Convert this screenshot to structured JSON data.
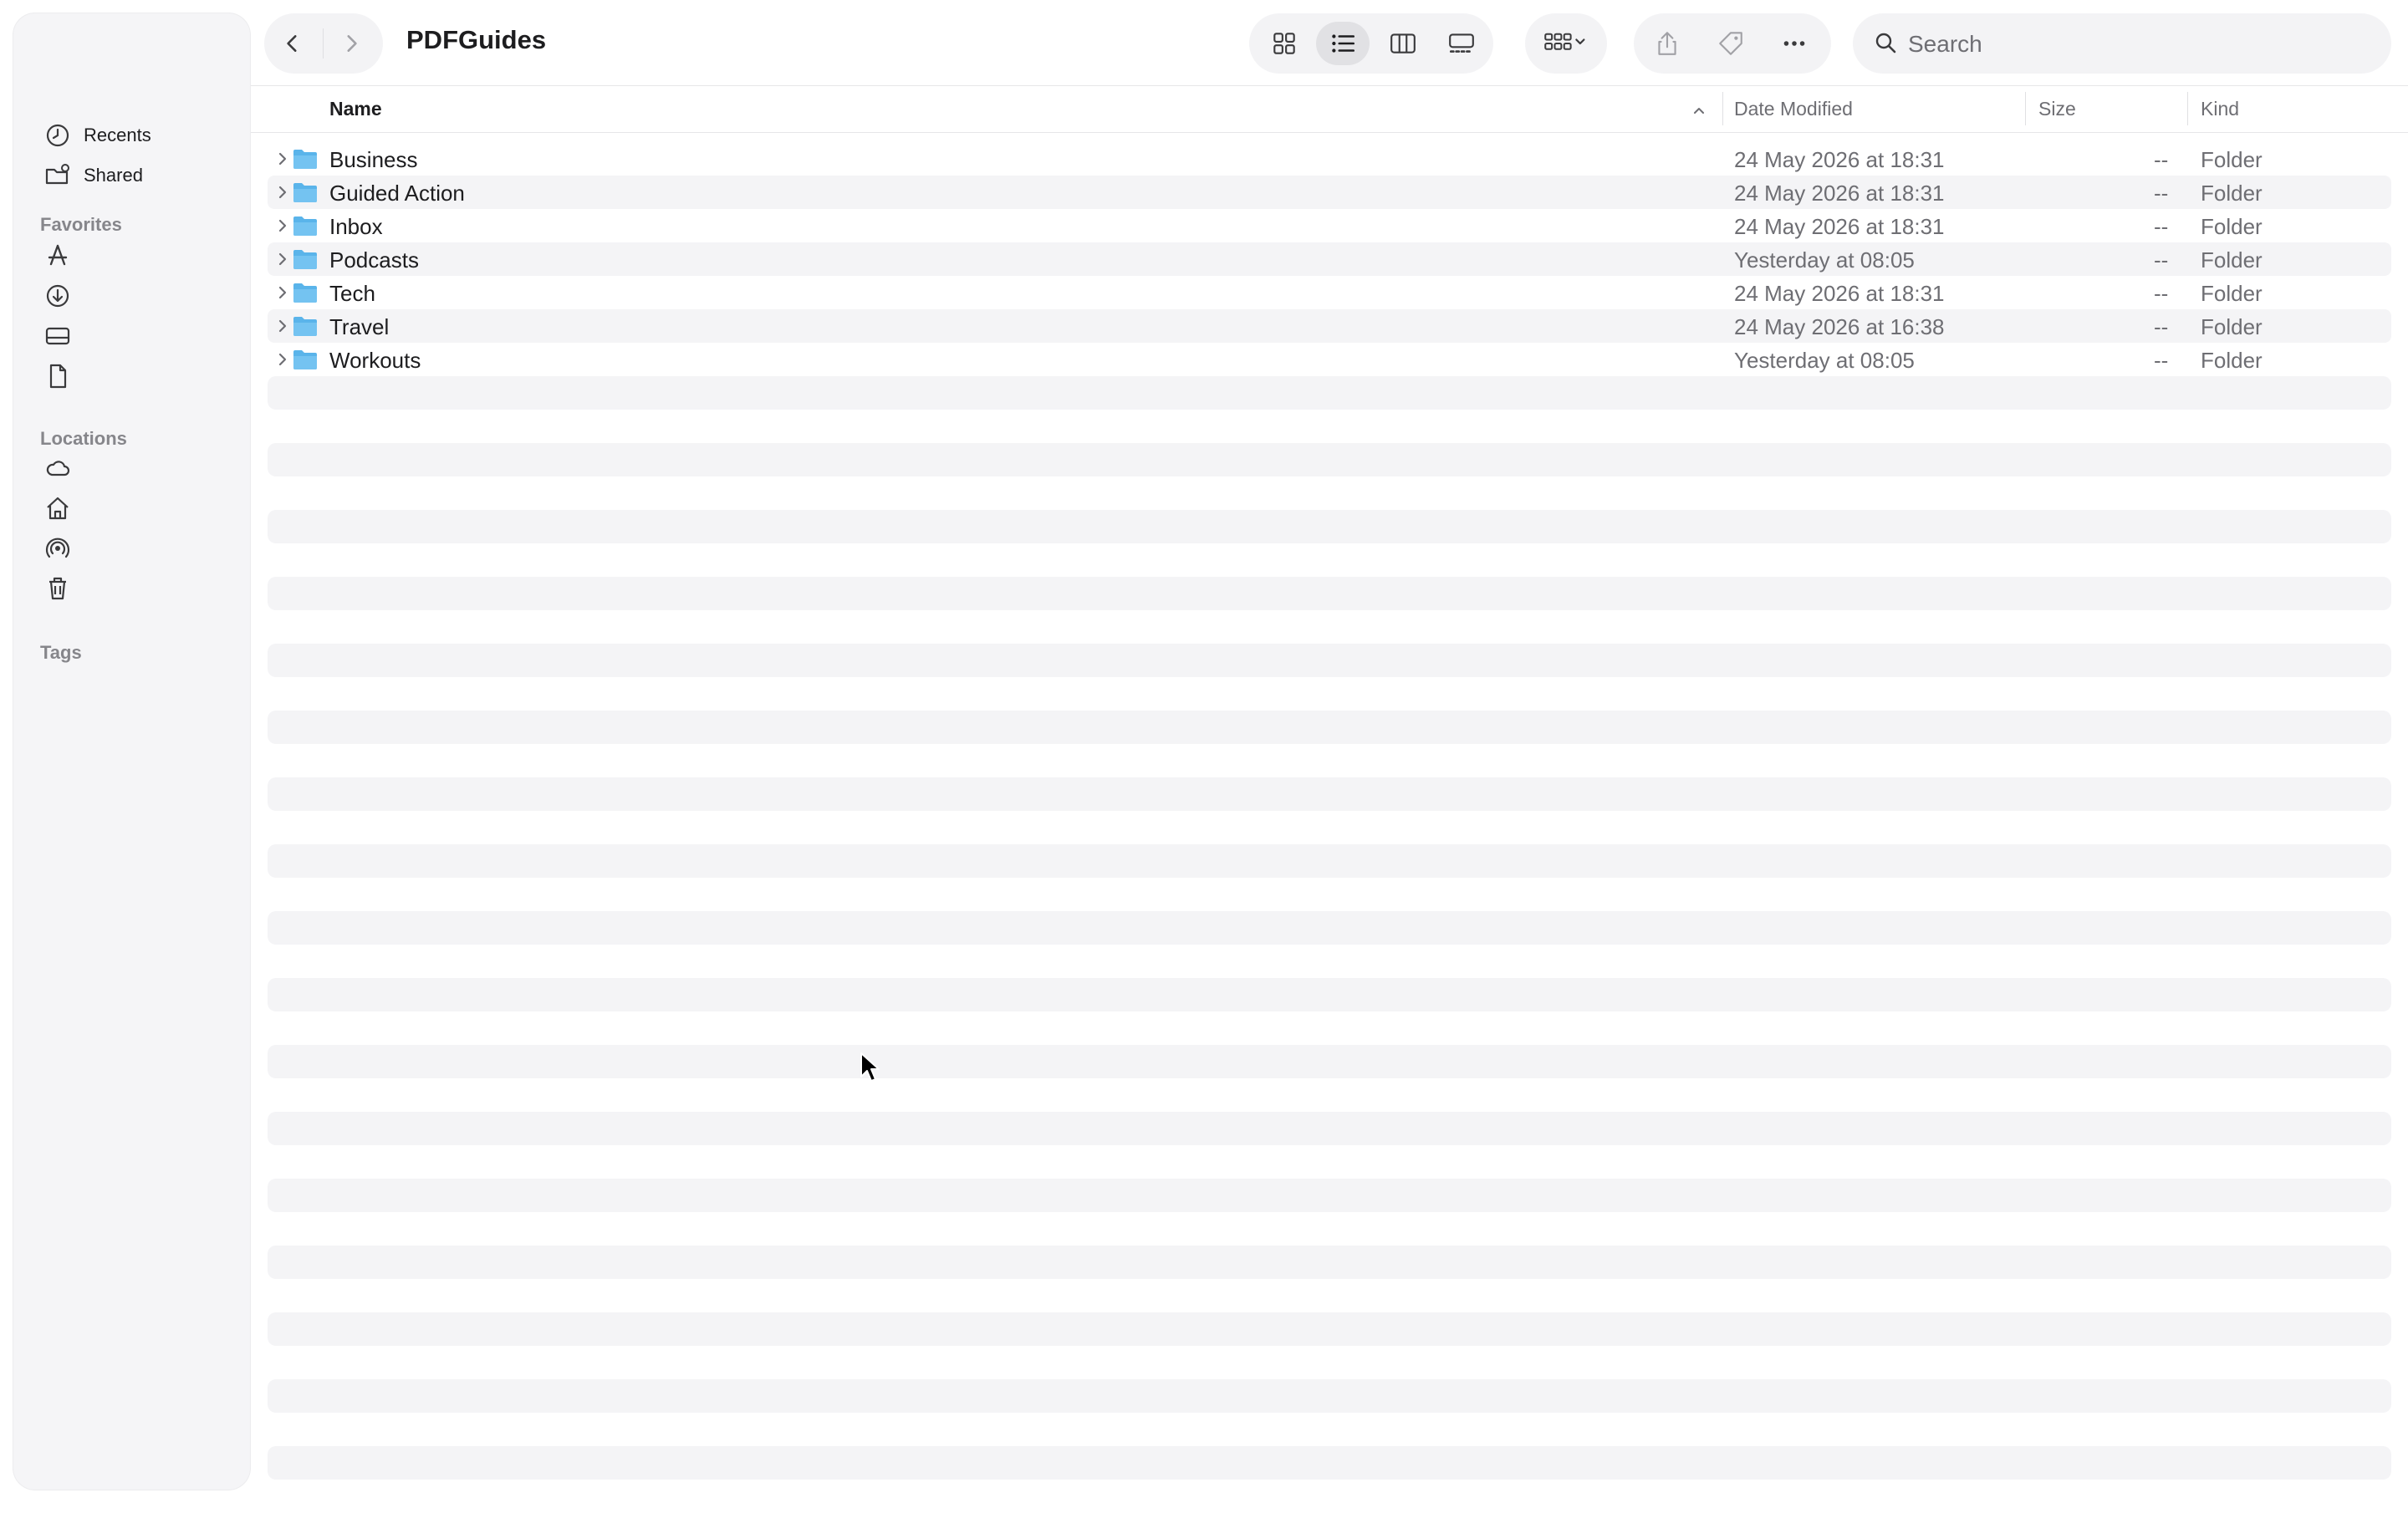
{
  "window": {
    "title": "PDFGuides"
  },
  "sidebar": {
    "top_items": [
      {
        "label": "Recents",
        "icon": "clock-icon"
      },
      {
        "label": "Shared",
        "icon": "shared-folder-icon"
      }
    ],
    "favorites_header": "Favorites",
    "favorites_icons": [
      "applications-icon",
      "downloads-icon",
      "desktop-icon",
      "document-icon"
    ],
    "locations_header": "Locations",
    "locations_icons": [
      "icloud-icon",
      "home-icon",
      "airdrop-icon",
      "trash-icon"
    ],
    "tags_header": "Tags"
  },
  "toolbar": {
    "view_modes": [
      "icon-view",
      "list-view",
      "column-view",
      "gallery-view"
    ],
    "selected_view": "list-view",
    "search_placeholder": "Search"
  },
  "columns": {
    "name": "Name",
    "date": "Date Modified",
    "size": "Size",
    "kind": "Kind",
    "sort": "ascending"
  },
  "files": [
    {
      "name": "Business",
      "date": "24 May 2026 at 18:31",
      "size": "--",
      "kind": "Folder"
    },
    {
      "name": "Guided Action",
      "date": "24 May 2026 at 18:31",
      "size": "--",
      "kind": "Folder"
    },
    {
      "name": "Inbox",
      "date": "24 May 2026 at 18:31",
      "size": "--",
      "kind": "Folder"
    },
    {
      "name": "Podcasts",
      "date": "Yesterday at 08:05",
      "size": "--",
      "kind": "Folder"
    },
    {
      "name": "Tech",
      "date": "24 May 2026 at 18:31",
      "size": "--",
      "kind": "Folder"
    },
    {
      "name": "Travel",
      "date": "24 May 2026 at 16:38",
      "size": "--",
      "kind": "Folder"
    },
    {
      "name": "Workouts",
      "date": "Yesterday at 08:05",
      "size": "--",
      "kind": "Folder"
    }
  ],
  "colors": {
    "folder": "#5ab4ea",
    "stripe": "#f4f4f6",
    "secondary_text": "#6e6e73"
  }
}
